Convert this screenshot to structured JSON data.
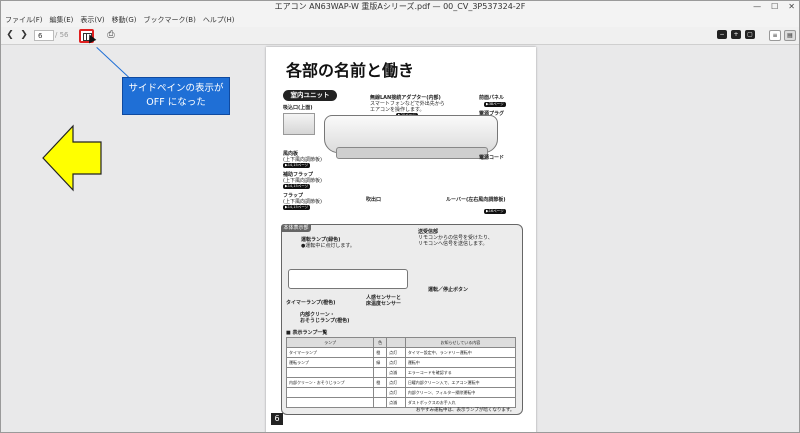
{
  "window": {
    "title": "エアコン AN63WAP-W 重版Aシリーズ.pdf — 00_CV_3P537324-2F"
  },
  "menu": [
    "ファイル(F)",
    "編集(E)",
    "表示(V)",
    "移動(G)",
    "ブックマーク(B)",
    "ヘルプ(H)"
  ],
  "toolbar": {
    "page_value": "6",
    "page_total": "/ 56"
  },
  "callout": {
    "line1": "サイドペインの表示が",
    "line2": "OFF になった"
  },
  "colors": {
    "callout_bg": "#1f6fd6",
    "highlight_border": "#e02020",
    "arrow_fill": "#ffff00"
  },
  "doc": {
    "title": "各部の名前と働き",
    "section_indoor": "室内ユニット",
    "labels": {
      "intake": "吸込口",
      "intake_note": "(上面)",
      "lan": "無線LAN接続アダプター",
      "lan_note": "(内部)",
      "lan_sub": "スマートフォンなどで外出先から",
      "lan_sub2": "エアコンを操作します。",
      "front_panel": "前面パネル",
      "power_plug": "電源プラグ",
      "wind_plate": "風向板",
      "wind_plate_note": "(上下風向調節板)",
      "aux_flap": "補助フラップ",
      "aux_flap_note": "(上下風向調節板)",
      "flap": "フラップ",
      "flap_note": "(上下風向調節板)",
      "outlet": "吹出口",
      "louver": "ルーバー",
      "louver_note": "(左右風向調節板)",
      "power_cord": "電源コード"
    },
    "pills": {
      "lan": "▶20ページ",
      "front": "▶38ページ",
      "wind": "▶14,15ページ",
      "aux": "▶14,15ページ",
      "flap": "▶14,15ページ",
      "louver": "▶16ページ"
    },
    "display_header": "本体表示部",
    "display": {
      "run_lamp": "運転ランプ",
      "run_lamp_color": "(緑色)",
      "run_lamp_note": "●運転中に点灯します。",
      "receiver": "送受信部",
      "receiver_note1": "リモコンからの信号を受けたり、",
      "receiver_note2": "リモコンへ信号を送信します。",
      "timer_lamp": "タイマーランプ",
      "timer_lamp_color": "(橙色)",
      "sensor": "人感センサーと",
      "sensor2": "床温度センサー",
      "clean_lamp": "内部クリーン・",
      "clean_lamp2": "おそうじランプ",
      "clean_lamp_color": "(橙色)",
      "stop_button": "運転／停止ボタン"
    },
    "lamp_list_header": "■ 表示ランプ一覧",
    "table": {
      "headers": [
        "ランプ",
        "色",
        "",
        "お知らせしている内容"
      ],
      "rows": [
        [
          "タイマーランプ",
          "橙",
          "点灯",
          "タイマー設定中、ランドリー運転中"
        ],
        [
          "運転ランプ",
          "緑",
          "点灯",
          "運転中"
        ],
        [
          "",
          "",
          "点滅",
          "エラーコードを確認する"
        ],
        [
          "内部クリーン・おそうじランプ",
          "橙",
          "点灯",
          "日曜内部クリーン入で、エアコン運転中"
        ],
        [
          "",
          "",
          "点灯",
          "内部クリーン、フィルター掃除運転中"
        ],
        [
          "",
          "",
          "点滅",
          "ダストボックスのお手入れ"
        ]
      ]
    },
    "footnote": "おやすみ運転中は、表示ランプが暗くなります。",
    "page_number": "6"
  }
}
